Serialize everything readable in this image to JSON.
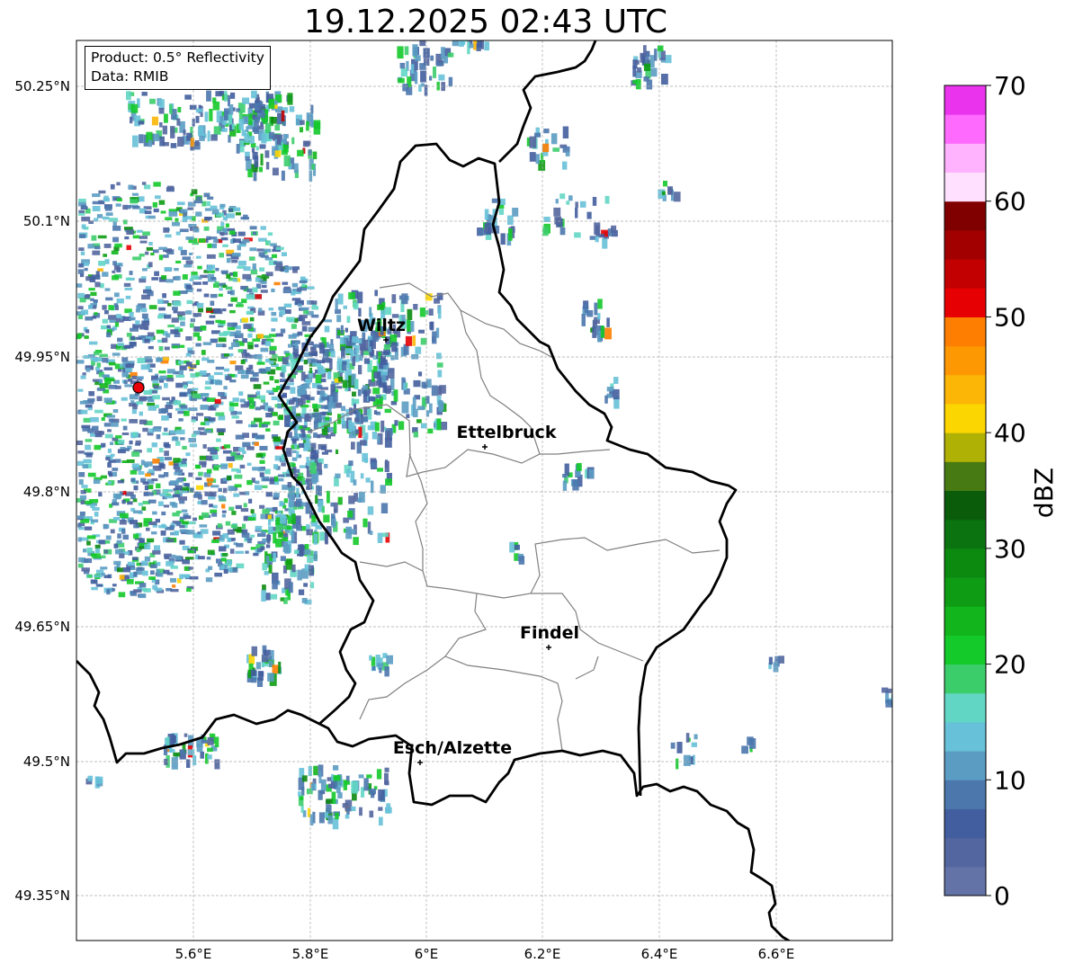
{
  "title": "19.12.2025 02:43 UTC",
  "info": {
    "product": "Product: 0.5° Reflectivity",
    "data": "Data: RMIB"
  },
  "axes": {
    "lon_ticks": [
      "5.6°E",
      "5.8°E",
      "6°E",
      "6.2°E",
      "6.4°E",
      "6.6°E"
    ],
    "lat_ticks": [
      "50.25°N",
      "50.1°N",
      "49.95°N",
      "49.8°N",
      "49.65°N",
      "49.5°N",
      "49.35°N"
    ]
  },
  "cities": [
    {
      "name": "Wiltz"
    },
    {
      "name": "Ettelbruck"
    },
    {
      "name": "Findel"
    },
    {
      "name": "Esch/Alzette"
    }
  ],
  "colorbar": {
    "label": "dBZ",
    "ticks": [
      "0",
      "10",
      "20",
      "30",
      "40",
      "50",
      "60",
      "70"
    ],
    "colors": [
      "#6373a8",
      "#53669f",
      "#435e9f",
      "#4b77ad",
      "#5b9cc3",
      "#67c1d8",
      "#62d6c4",
      "#3ccd6b",
      "#14c92a",
      "#12b51b",
      "#0e9c14",
      "#0c8a10",
      "#0b7310",
      "#0a5c0b",
      "#487a13",
      "#b0b105",
      "#fcd600",
      "#fcb606",
      "#fd9802",
      "#fd7e00",
      "#e70003",
      "#c20002",
      "#a20000",
      "#800000",
      "#ffe1ff",
      "#ffb3ff",
      "#fe6afe",
      "#ea33ed"
    ]
  },
  "radar_site": {
    "color": "#e8000b"
  }
}
